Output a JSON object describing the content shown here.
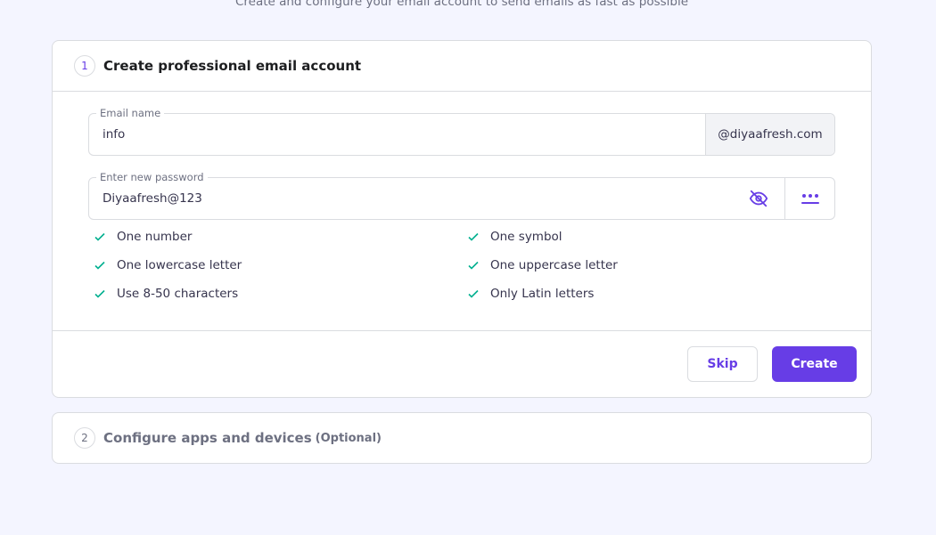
{
  "header": {
    "subtitle": "Create and configure your email account to send emails as fast as possible"
  },
  "steps": [
    {
      "number": "1",
      "title": "Create professional email account",
      "email_field": {
        "label": "Email name",
        "value": "info",
        "domain_suffix": "@diyaafresh.com"
      },
      "password_field": {
        "label": "Enter new password",
        "value": "Diyaafresh@123",
        "toggle_icon": "eye-off-icon",
        "generate_icon": "dots-generate-icon"
      },
      "requirements": [
        {
          "label": "One number",
          "met": true
        },
        {
          "label": "One symbol",
          "met": true
        },
        {
          "label": "One lowercase letter",
          "met": true
        },
        {
          "label": "One uppercase letter",
          "met": true
        },
        {
          "label": "Use 8-50 characters",
          "met": true
        },
        {
          "label": "Only Latin letters",
          "met": true
        }
      ],
      "buttons": {
        "skip": "Skip",
        "create": "Create"
      }
    },
    {
      "number": "2",
      "title": "Configure apps and devices",
      "tag": "(Optional)"
    }
  ],
  "colors": {
    "accent": "#673de6",
    "check": "#00b090",
    "background": "#f4f5ff"
  }
}
